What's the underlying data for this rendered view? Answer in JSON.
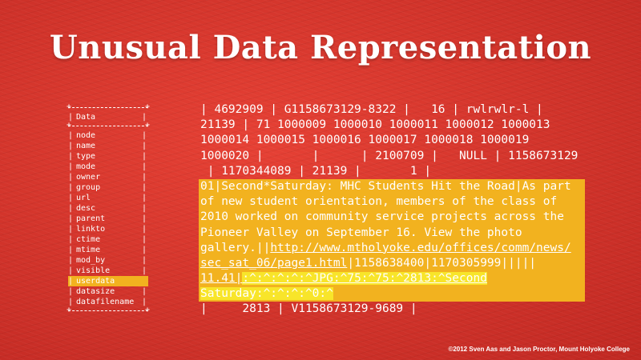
{
  "title": "Unusual Data Representation",
  "table": {
    "header": "Data",
    "fields": [
      "node",
      "name",
      "type",
      "mode",
      "owner",
      "group",
      "url",
      "desc",
      "parent",
      "linkto",
      "ctime",
      "mtime",
      "mod_by",
      "visible",
      "userdata",
      "datasize",
      "datafilename"
    ],
    "highlighted_index": 14
  },
  "record": {
    "plain_lines_before": [
      "| 4692909 | G1158673129-8322 |   16 | rwlrwlr-l |",
      "21139 | 71 1000009 1000010 1000011 1000012 1000013",
      "1000014 1000015 1000016 1000017 1000018 1000019",
      "1000020 |       |      | 2100709 |   NULL | 1158673129",
      " | 1170344089 | 21139 |       1 |"
    ],
    "hl_lines": [
      "01|Second*Saturday: MHC Students Hit the Road|As part",
      "of new student orientation, members of the class of",
      "2010 worked on community service projects across the",
      "Pioneer Valley on September 16. View the photo"
    ],
    "hl_gallery_prefix": "gallery.||",
    "hl_link_part1": "http://www.mtholyoke.edu/offices/comm/news/",
    "hl_link_part2": "sec_sat_06/page1.html",
    "hl_line7_tail": "|1158638400|1170305999|||||",
    "hl_line8_a": "11.41|",
    "hl_line8_b": ":^:^:^:^:^JPG:^75:^75:^2813:^Second",
    "hl_line9": "Saturday:^:^:^:^0:^",
    "plain_lines_after": [
      "|     2813 | V1158673129-9689 |"
    ]
  },
  "credit": "©2012 Sven Aas and Jason Proctor, Mount Holyoke College",
  "colors": {
    "background": "#d9332b",
    "highlight": "#f2b21f",
    "highlight_inner": "#f8e52a",
    "text": "#ffffff"
  }
}
